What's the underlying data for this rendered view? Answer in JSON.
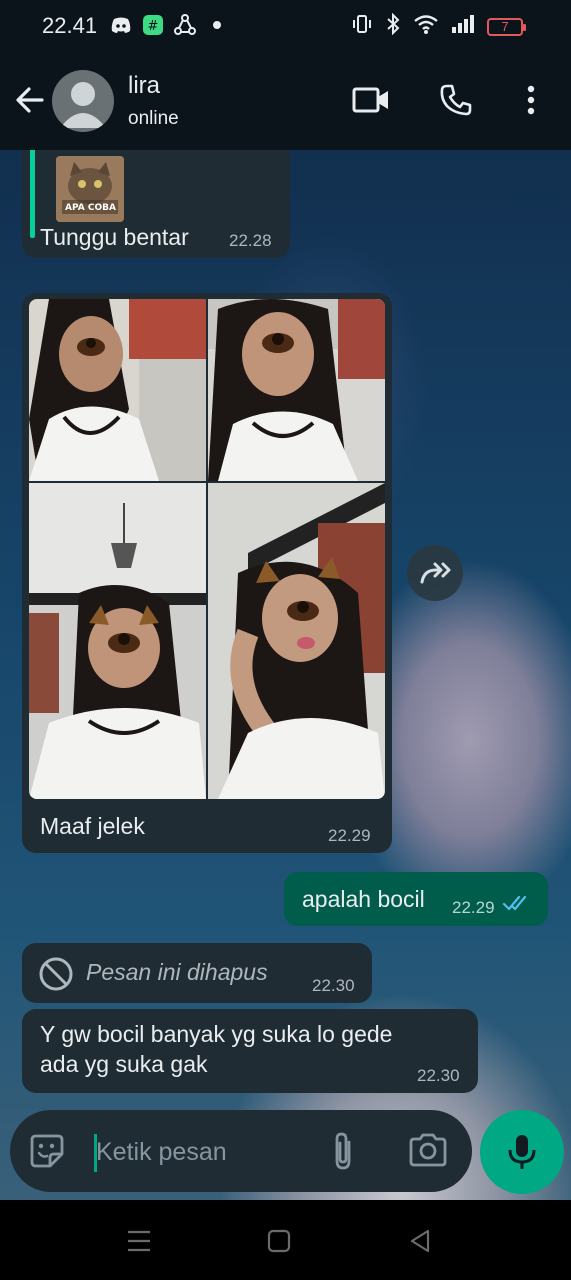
{
  "status_bar": {
    "time": "22.41",
    "battery": "7"
  },
  "header": {
    "contact_name": "lira",
    "contact_status": "online"
  },
  "messages": {
    "reply_text": "Tunggu bentar",
    "reply_time": "22.28",
    "reply_thumb_caption": "APA COBA",
    "photos_caption": "Maaf jelek",
    "photos_time": "22.29",
    "sent_text": "apalah bocil",
    "sent_time": "22.29",
    "deleted_text": "Pesan ini dihapus",
    "deleted_time": "22.30",
    "last_line1": "Y gw bocil banyak yg suka lo gede",
    "last_line2": "ada yg suka gak",
    "last_time": "22.30"
  },
  "input": {
    "placeholder": "Ketik pesan"
  },
  "colors": {
    "app_bg": "#0b141a",
    "incoming_bubble": "#202c33",
    "outgoing_bubble": "#005c4b",
    "accent": "#00a884",
    "read_ticks": "#53bdeb"
  },
  "icons": [
    "back-arrow-icon",
    "default-avatar-icon",
    "video-call-icon",
    "phone-icon",
    "more-vert-icon",
    "forward-icon",
    "block-icon",
    "read-ticks-icon",
    "sticker-icon",
    "attach-icon",
    "camera-icon",
    "mic-icon"
  ]
}
